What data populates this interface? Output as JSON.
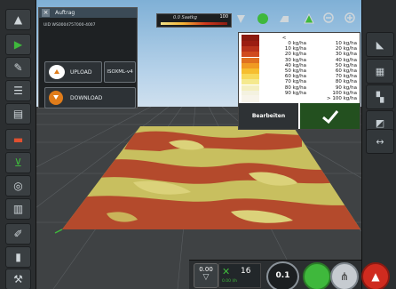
{
  "panel": {
    "title": "Auftrag",
    "id_line": "UID    WS0004757000-4007",
    "upload_label": "UPLOAD",
    "isoxml_label": "ISOXML-v4",
    "download_label": "DOWNLOAD"
  },
  "rate_bar": {
    "label": "0.0 Saatkg",
    "max": "100"
  },
  "legend": {
    "header": "<",
    "rows": [
      {
        "from": "0 kg/ha",
        "to": "10 kg/ha",
        "color": "#9b1d12"
      },
      {
        "from": "10 kg/ha",
        "to": "20 kg/ha",
        "color": "#b8321b"
      },
      {
        "from": "20 kg/ha",
        "to": "30 kg/ha",
        "color": "#d04a1e"
      },
      {
        "from": "30 kg/ha",
        "to": "40 kg/ha",
        "color": "#e0711f"
      },
      {
        "from": "40 kg/ha",
        "to": "50 kg/ha",
        "color": "#f09a23"
      },
      {
        "from": "50 kg/ha",
        "to": "60 kg/ha",
        "color": "#f6be2f"
      },
      {
        "from": "60 kg/ha",
        "to": "70 kg/ha",
        "color": "#f7d95a"
      },
      {
        "from": "70 kg/ha",
        "to": "80 kg/ha",
        "color": "#f5e98e"
      },
      {
        "from": "80 kg/ha",
        "to": "90 kg/ha",
        "color": "#f4efc0"
      },
      {
        "from": "90 kg/ha",
        "to": "100 kg/ha",
        "color": "#f4f2e0"
      }
    ],
    "footer": "> 100 kg/ha",
    "edit_label": "Bearbeiten"
  },
  "bottom": {
    "left_value": "0.00",
    "count": "16",
    "sub_value": "0.00 l/h",
    "gauge": "0.1"
  },
  "colors": {
    "field_red": "#b0452a",
    "field_yellow": "#c8c060",
    "accent_orange": "#e07c1a",
    "ok_green": "#3fb83c"
  }
}
